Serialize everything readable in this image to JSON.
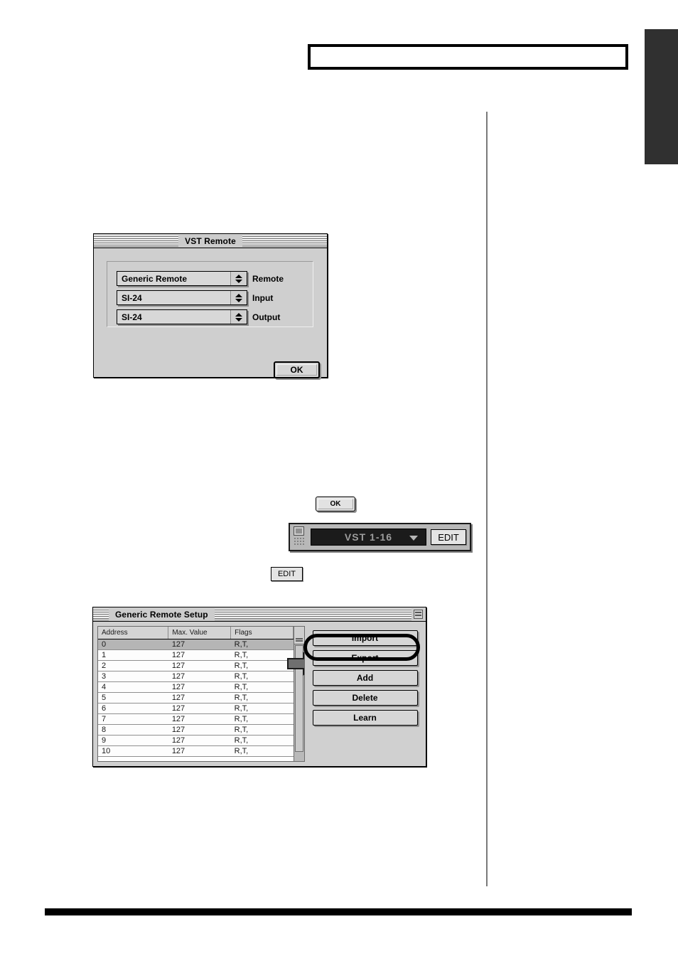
{
  "page": {
    "tab_marker": "side-tab",
    "callout_box": "",
    "footer_rule": ""
  },
  "vst_remote_dialog": {
    "title": "VST Remote",
    "rows": [
      {
        "value": "Generic Remote",
        "caption": "Remote"
      },
      {
        "value": "SI-24",
        "caption": "Input"
      },
      {
        "value": "SI-24",
        "caption": "Output"
      }
    ],
    "ok_label": "OK"
  },
  "standalone_ok": {
    "label": "OK"
  },
  "vst_strip": {
    "display_value": "VST 1-16",
    "edit_label": "EDIT"
  },
  "standalone_edit": {
    "label": "EDIT"
  },
  "generic_remote_setup": {
    "title": "Generic Remote Setup",
    "columns": [
      "Address",
      "Max. Value",
      "Flags"
    ],
    "rows": [
      {
        "address": "0",
        "max_value": "127",
        "flags": "R,T,"
      },
      {
        "address": "1",
        "max_value": "127",
        "flags": "R,T,"
      },
      {
        "address": "2",
        "max_value": "127",
        "flags": "R,T,"
      },
      {
        "address": "3",
        "max_value": "127",
        "flags": "R,T,"
      },
      {
        "address": "4",
        "max_value": "127",
        "flags": "R,T,"
      },
      {
        "address": "5",
        "max_value": "127",
        "flags": "R,T,"
      },
      {
        "address": "6",
        "max_value": "127",
        "flags": "R,T,"
      },
      {
        "address": "7",
        "max_value": "127",
        "flags": "R,T,"
      },
      {
        "address": "8",
        "max_value": "127",
        "flags": "R,T,"
      },
      {
        "address": "9",
        "max_value": "127",
        "flags": "R,T,"
      },
      {
        "address": "10",
        "max_value": "127",
        "flags": "R,T,"
      }
    ],
    "selected_row_index": 0,
    "buttons": [
      {
        "label": "Import",
        "highlighted": true
      },
      {
        "label": "Export",
        "highlighted": false
      },
      {
        "label": "Add",
        "highlighted": false
      },
      {
        "label": "Delete",
        "highlighted": false
      },
      {
        "label": "Learn",
        "highlighted": false
      }
    ]
  },
  "colors": {
    "window_face": "#cfcfcf",
    "button_face": "#d6d6d6",
    "lcd_background": "#1b1b1b",
    "lcd_text": "#9d9d9d",
    "selection": "#b5b5b5",
    "tab_marker": "#303030"
  }
}
